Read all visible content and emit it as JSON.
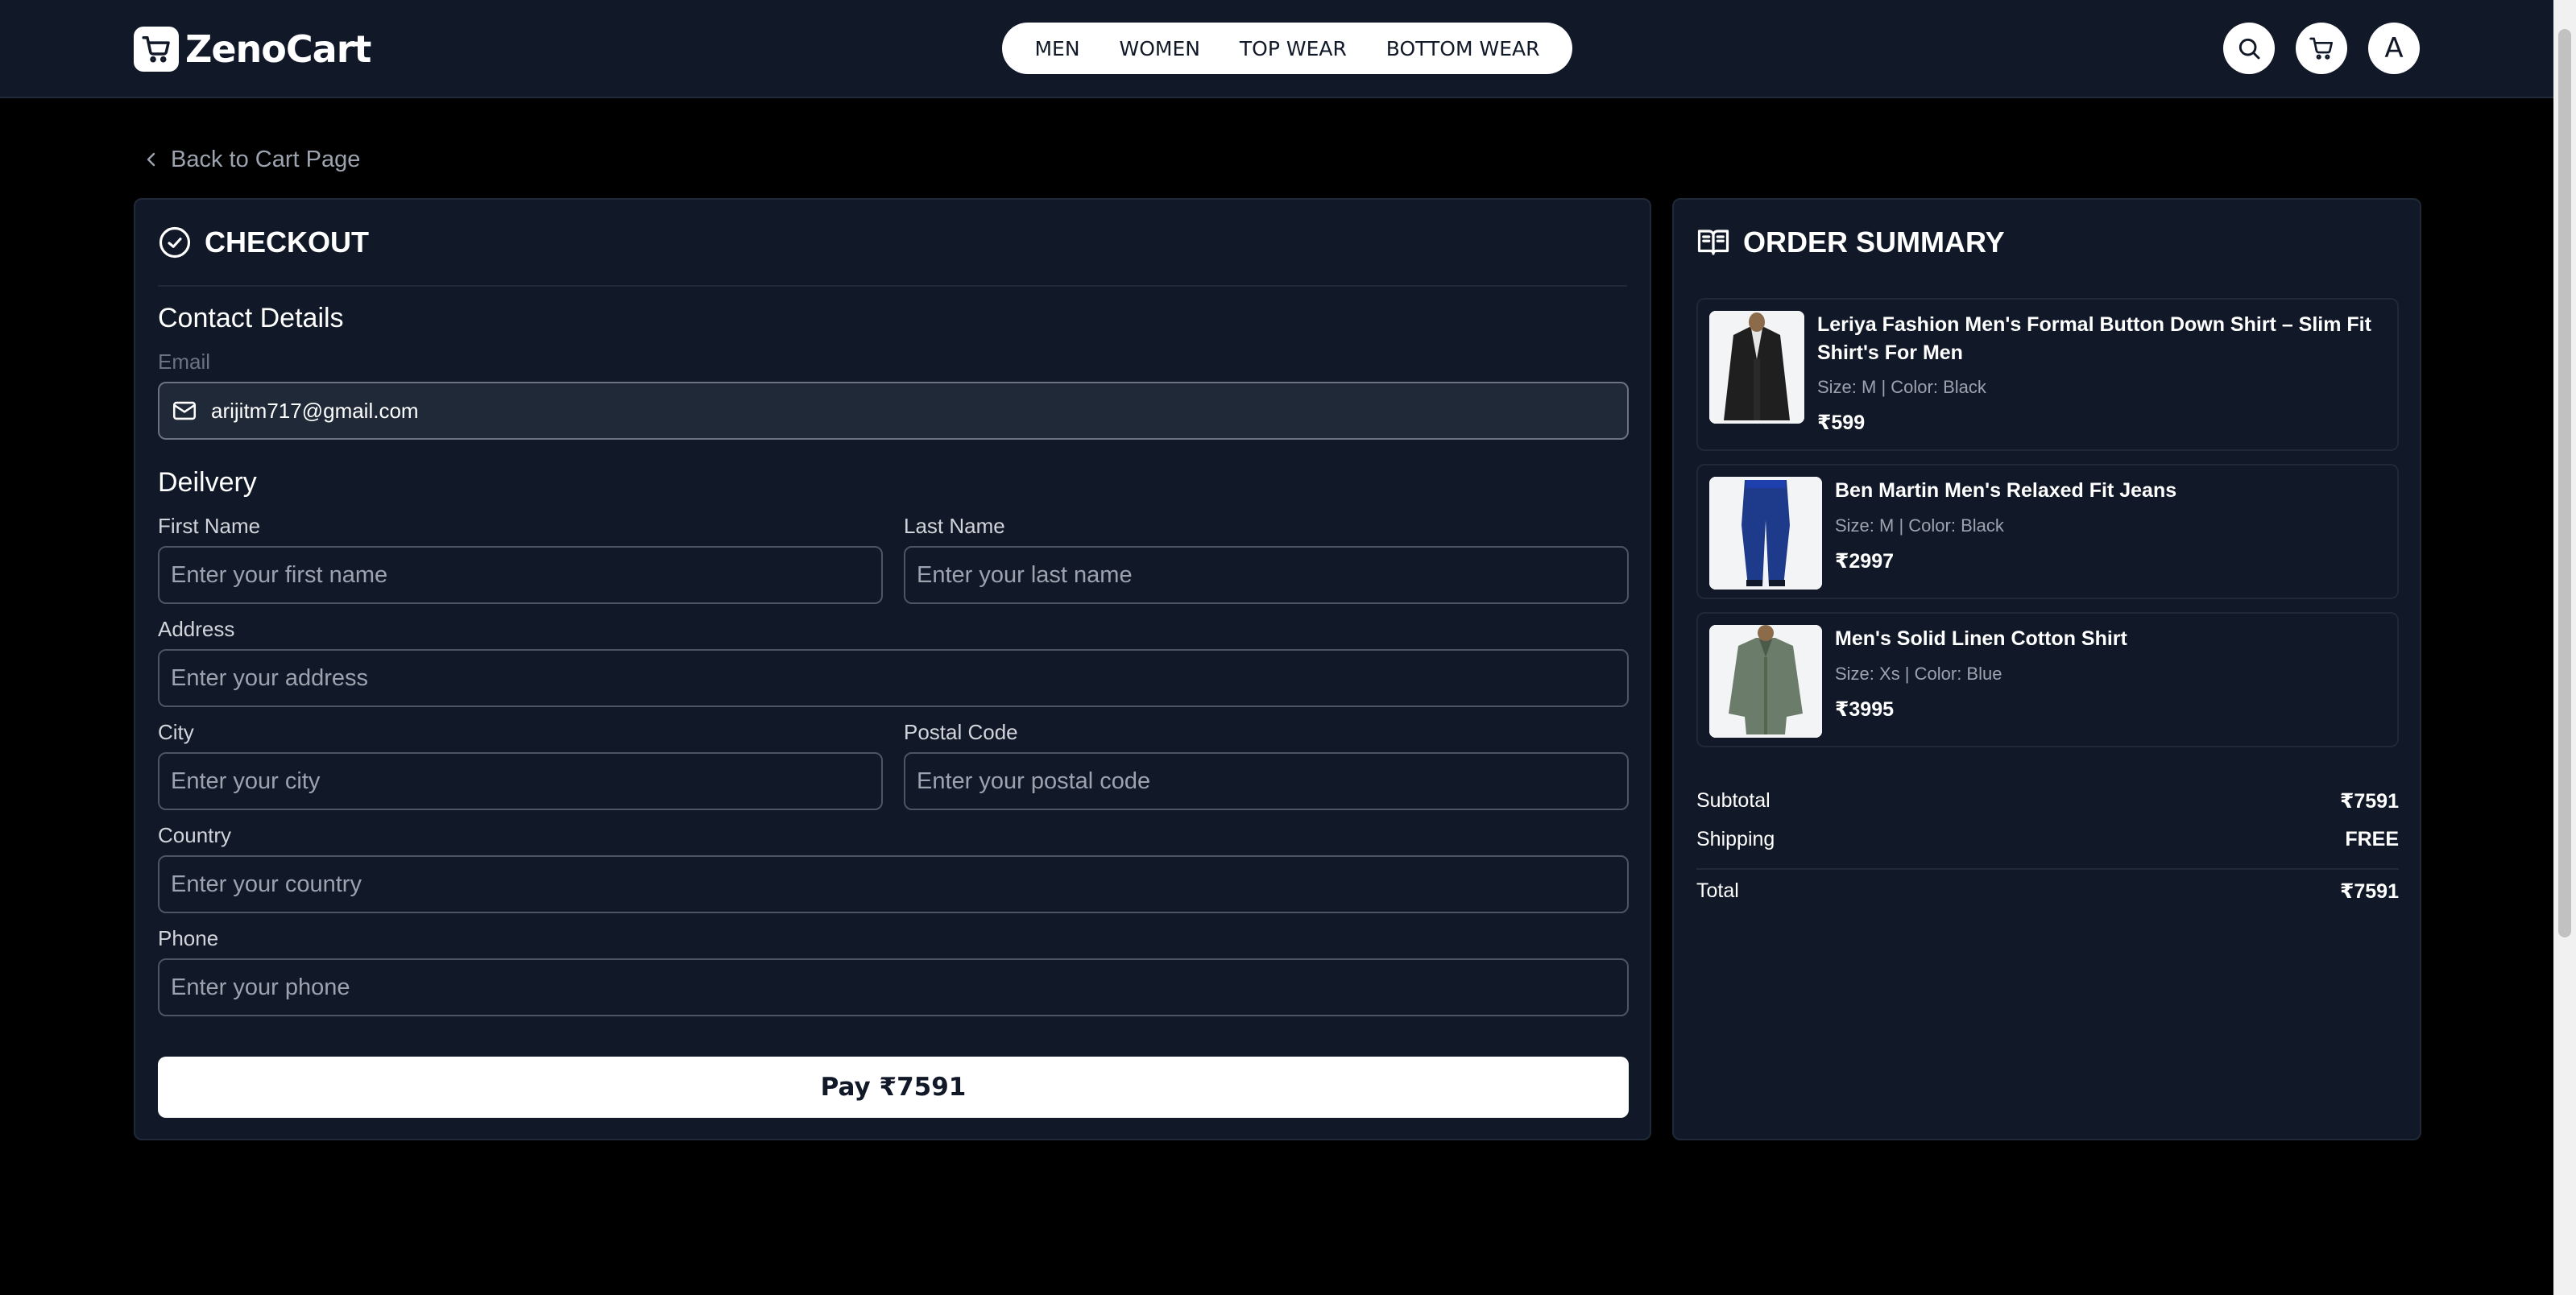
{
  "brand": {
    "name": "ZenoCart"
  },
  "nav": {
    "items": [
      "MEN",
      "WOMEN",
      "TOP WEAR",
      "BOTTOM WEAR"
    ]
  },
  "header": {
    "avatar_letter": "A",
    "search_icon": "search-icon",
    "cart_icon": "cart-icon"
  },
  "back_link": {
    "label": "Back to Cart Page"
  },
  "checkout": {
    "title": "CHECKOUT",
    "contact_heading": "Contact Details",
    "email_label": "Email",
    "email_value": "arijitm717@gmail.com",
    "delivery_heading": "Deilvery",
    "first_name_label": "First Name",
    "first_name_placeholder": "Enter your first name",
    "last_name_label": "Last Name",
    "last_name_placeholder": "Enter your last name",
    "address_label": "Address",
    "address_placeholder": "Enter your address",
    "city_label": "City",
    "city_placeholder": "Enter your city",
    "postal_label": "Postal Code",
    "postal_placeholder": "Enter your postal code",
    "country_label": "Country",
    "country_placeholder": "Enter your country",
    "phone_label": "Phone",
    "phone_placeholder": "Enter your phone",
    "pay_label": "Pay ₹7591"
  },
  "summary": {
    "title": "ORDER SUMMARY",
    "items": [
      {
        "name": "Leriya Fashion Men's Formal Button Down Shirt – Slim Fit Shirt's For Men",
        "meta": "Size: M | Color: Black",
        "price": "₹599"
      },
      {
        "name": "Ben Martin Men's Relaxed Fit Jeans",
        "meta": "Size: M | Color: Black",
        "price": "₹2997"
      },
      {
        "name": "Men's Solid Linen Cotton Shirt",
        "meta": "Size: Xs | Color: Blue",
        "price": "₹3995"
      }
    ],
    "subtotal_label": "Subtotal",
    "subtotal_value": "₹7591",
    "shipping_label": "Shipping",
    "shipping_value": "FREE",
    "total_label": "Total",
    "total_value": "₹7591"
  },
  "colors": {
    "background": "#000000",
    "panel": "#111827",
    "border": "#1f2937",
    "accent": "#ffffff"
  }
}
